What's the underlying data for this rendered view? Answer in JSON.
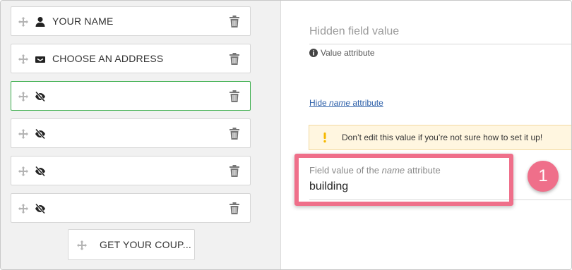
{
  "fields": [
    {
      "label": "YOUR NAME",
      "icon": "user-icon"
    },
    {
      "label": "CHOOSE AN ADDRESS",
      "icon": "address-card-icon"
    },
    {
      "label": "",
      "icon": "eye-slash-icon",
      "active": true
    },
    {
      "label": "",
      "icon": "eye-slash-icon"
    },
    {
      "label": "",
      "icon": "eye-slash-icon"
    },
    {
      "label": "",
      "icon": "eye-slash-icon"
    }
  ],
  "coupon_button": {
    "label": "GET YOUR COUP..."
  },
  "settings": {
    "hidden_value_title": "Hidden field value",
    "value_attribute": "Value attribute",
    "hide_link": {
      "pre": "Hide ",
      "em": "name",
      "post": " attribute"
    },
    "warning": "Don’t edit this value if you’re not sure how to set it up!",
    "field_value_label": {
      "pre": "Field value of the ",
      "em": "name",
      "post": " attribute"
    },
    "field_value": "building"
  },
  "callout": {
    "number": "1"
  },
  "colors": {
    "accent_green": "#3cae4c",
    "highlight": "#ef6f8a",
    "warning_bg": "#fff6e0",
    "warning_icon": "#f5b800"
  }
}
